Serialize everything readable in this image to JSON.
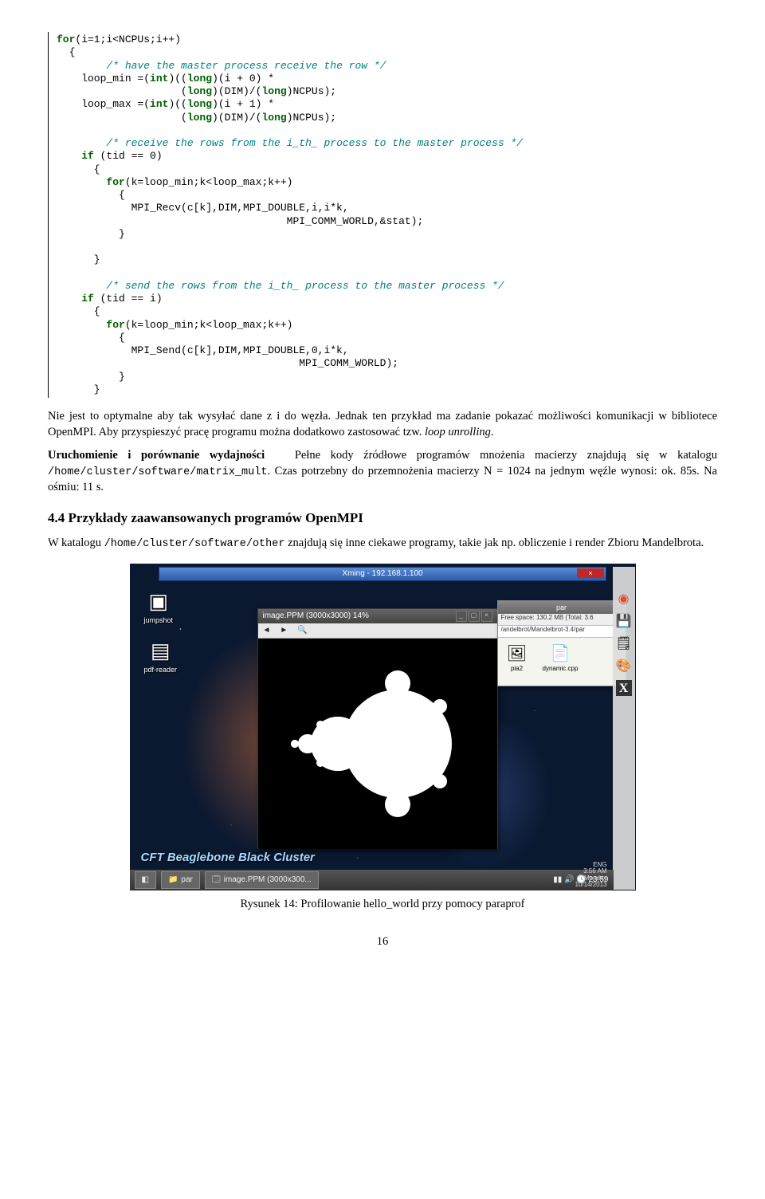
{
  "code": {
    "l0": "for(i=1;i<NCPUs;i++)",
    "l1": "  {",
    "l2": "    /* have the master process receive the row */",
    "l3a": "    loop_min =(int)((long)(i + 0) *",
    "l3b": "                    (long)(DIM)/(long)NCPUs);",
    "l4a": "    loop_max =(int)((long)(i + 1) *",
    "l4b": "                    (long)(DIM)/(long)NCPUs);",
    "l5": "",
    "l6": "    /* receive the rows from the i_th_ process to the master process */",
    "l7": "    if (tid == 0)",
    "l8": "      {",
    "l9": "        for(k=loop_min;k<loop_max;k++)",
    "l10": "          {",
    "l11a": "            MPI_Recv(c[k],DIM,MPI_DOUBLE,i,i*k,",
    "l11b": "                                     MPI_COMM_WORLD,&stat);",
    "l12": "          }",
    "l13": "",
    "l14": "      }",
    "l15": "",
    "l16": "    /* send the rows from the i_th_ process to the master process */",
    "l17": "    if (tid == i)",
    "l18": "      {",
    "l19": "        for(k=loop_min;k<loop_max;k++)",
    "l20": "          {",
    "l21a": "            MPI_Send(c[k],DIM,MPI_DOUBLE,0,i*k,",
    "l21b": "                                       MPI_COMM_WORLD);",
    "l22": "          }",
    "l23": "      }"
  },
  "para1": "Nie jest to optymalne aby tak wysyłać dane z i do węzła. Jednak ten przykład ma zadanie pokazać możliwości komunikacji w bibliotece OpenMPI. Aby przyspieszyć pracę programu można dodatkowo zastosować tzw. ",
  "para1_em": "loop unrolling",
  "para1_end": ".",
  "para2_head": "Uruchomienie i porównanie wydajności",
  "para2a": "Pełne kody źródłowe programów mnożenia macierzy znajdują się w katalogu ",
  "para2_path": "/home/cluster/software/matrix_mult",
  "para2b": ". Czas potrzebny do przemnożenia macierzy N = 1024 na jednym węźle wynosi: ok. 85s. Na ośmiu: 11 s.",
  "section": "4.4   Przykłady zaawansowanych programów OpenMPI",
  "para3a": "W katalogu ",
  "para3_path": "/home/cluster/software/other",
  "para3b": " znajdują się inne ciekawe programy, takie jak np. obliczenie i render Zbioru Mandelbrota.",
  "figure": {
    "xming_title": "Xming - 192.168.1.100",
    "img_title": "image.PPM (3000x3000) 14%",
    "folder_title": "par",
    "folder_tb": "Free space: 130.2 MB (Total: 3.6",
    "folder_addr": "/andelbrot/Mandelbrot-3.4/par",
    "icon1": "pia2",
    "icon2": "dynamic.cpp",
    "desk1": "jumpshot",
    "desk2": "pdf-reader",
    "cft": "CFT Beaglebone Black Cluster",
    "task1": "par",
    "task2": "image.PPM (3000x300...",
    "clock_time": "23:59",
    "tray1": "ENG",
    "tray2": "3:56 AM",
    "tray3": "Monday",
    "tray4": "10/14/2013",
    "close_x": "×"
  },
  "caption": "Rysunek 14: Profilowanie hello_world przy pomocy paraprof",
  "page": "16"
}
